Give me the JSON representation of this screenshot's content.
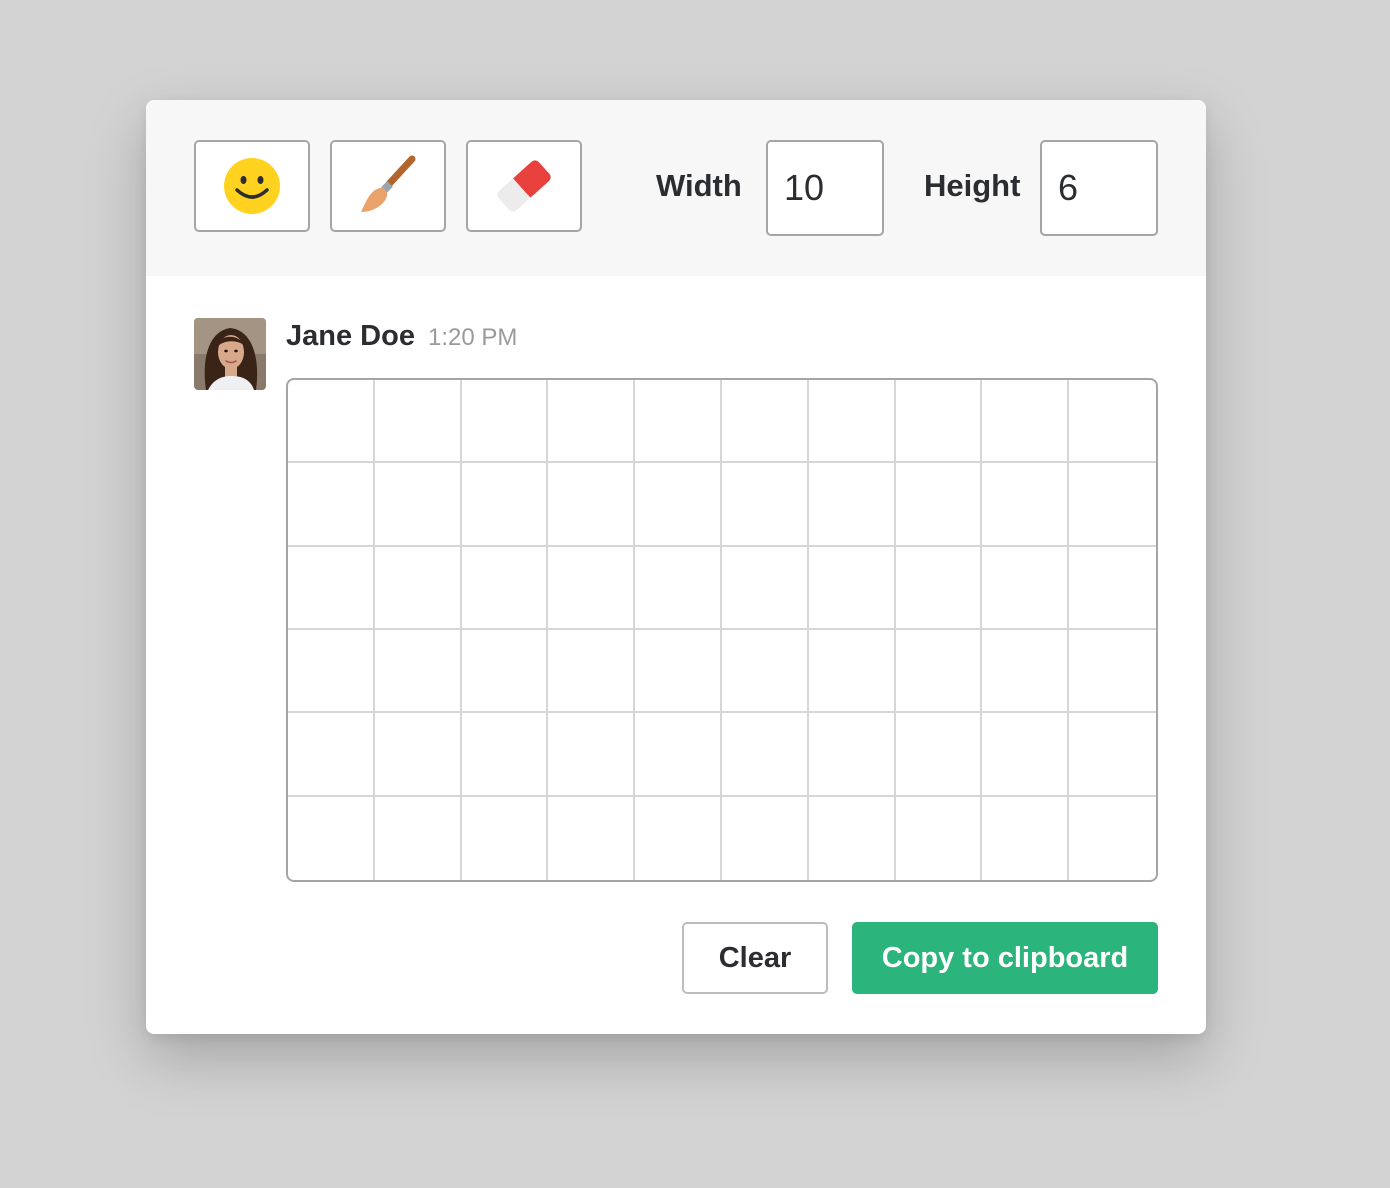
{
  "toolbar": {
    "tools": [
      {
        "name": "emoji",
        "icon": "smiley-face-icon"
      },
      {
        "name": "brush",
        "icon": "paintbrush-icon"
      },
      {
        "name": "eraser",
        "icon": "eraser-icon"
      }
    ],
    "width_label": "Width",
    "width_value": "10",
    "height_label": "Height",
    "height_value": "6"
  },
  "message": {
    "author": "Jane Doe",
    "time": "1:20 PM",
    "avatar_icon": "user-avatar"
  },
  "canvas": {
    "columns": 10,
    "rows": 6
  },
  "actions": {
    "clear_label": "Clear",
    "copy_label": "Copy to clipboard"
  },
  "colors": {
    "accent": "#2bb47b",
    "emoji_yellow": "#ffd21f",
    "eraser_red": "#e8413d",
    "background": "#d3d3d3"
  }
}
